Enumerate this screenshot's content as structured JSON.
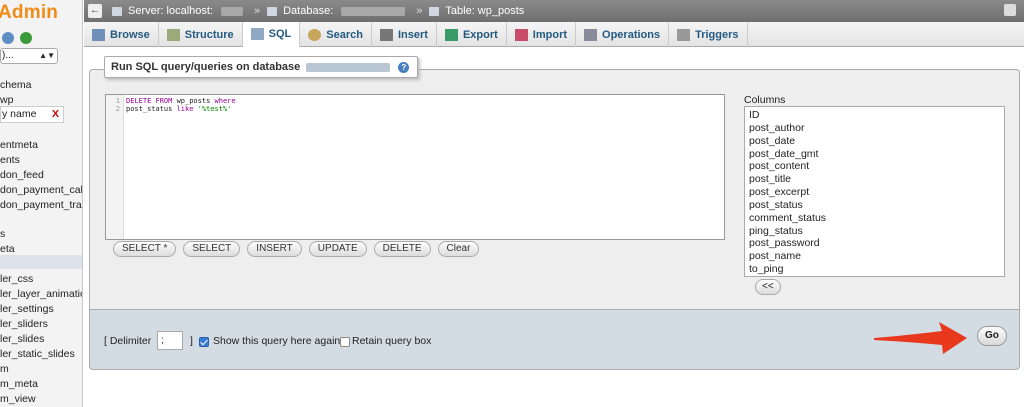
{
  "sidebar": {
    "logo_text": "Admin",
    "select_value": ")...",
    "filter_text": "y name",
    "filter_clear": "X",
    "items": [
      {
        "label": "chema"
      },
      {
        "label": "wp"
      },
      {
        "label": "entmeta"
      },
      {
        "label": "ents"
      },
      {
        "label": "don_feed"
      },
      {
        "label": "don_payment_callb"
      },
      {
        "label": "don_payment_trans"
      },
      {
        "label": "s"
      },
      {
        "label": "eta"
      },
      {
        "label": "ler_css"
      },
      {
        "label": "ler_layer_animation"
      },
      {
        "label": "ler_settings"
      },
      {
        "label": "ler_sliders"
      },
      {
        "label": "ler_slides"
      },
      {
        "label": "ler_static_slides"
      },
      {
        "label": "m"
      },
      {
        "label": "m_meta"
      },
      {
        "label": "m_view"
      }
    ]
  },
  "breadcrumb": {
    "server": "Server: localhost:",
    "database": "Database:",
    "table": "Table: wp_posts"
  },
  "tabs": [
    {
      "label": "Browse",
      "icon": "browse-icon"
    },
    {
      "label": "Structure",
      "icon": "structure-icon"
    },
    {
      "label": "SQL",
      "icon": "sql-icon",
      "active": true
    },
    {
      "label": "Search",
      "icon": "search-icon"
    },
    {
      "label": "Insert",
      "icon": "insert-icon"
    },
    {
      "label": "Export",
      "icon": "export-icon"
    },
    {
      "label": "Import",
      "icon": "import-icon"
    },
    {
      "label": "Operations",
      "icon": "wrench-icon"
    },
    {
      "label": "Triggers",
      "icon": "triggers-icon"
    }
  ],
  "sql_panel": {
    "legend": "Run SQL query/queries on database",
    "help": "?",
    "line_numbers": [
      "1",
      "2"
    ],
    "code_line1_kw1": "DELETE FROM",
    "code_line1_mid": " wp_posts ",
    "code_line1_kw2": "where",
    "code_line2_a": "post_status ",
    "code_line2_kw": "like",
    "code_line2_str": " '%test%'",
    "buttons": [
      "SELECT *",
      "SELECT",
      "INSERT",
      "UPDATE",
      "DELETE",
      "Clear"
    ]
  },
  "columns": {
    "label": "Columns",
    "items": [
      "ID",
      "post_author",
      "post_date",
      "post_date_gmt",
      "post_content",
      "post_title",
      "post_excerpt",
      "post_status",
      "comment_status",
      "ping_status",
      "post_password",
      "post_name",
      "to_ping"
    ],
    "insert_button": "<<"
  },
  "footer": {
    "delimiter_open": "[ Delimiter",
    "delimiter_value": ";",
    "delimiter_close": "]",
    "show_query_label": "Show this query here again",
    "show_query_checked": true,
    "retain_label": "Retain query box",
    "retain_checked": false,
    "go_label": "Go"
  },
  "colors": {
    "tab_text": "#235a81",
    "logo": "#f08c1a",
    "arrow": "#e8391f",
    "footer_bg": "#d3dce3"
  }
}
